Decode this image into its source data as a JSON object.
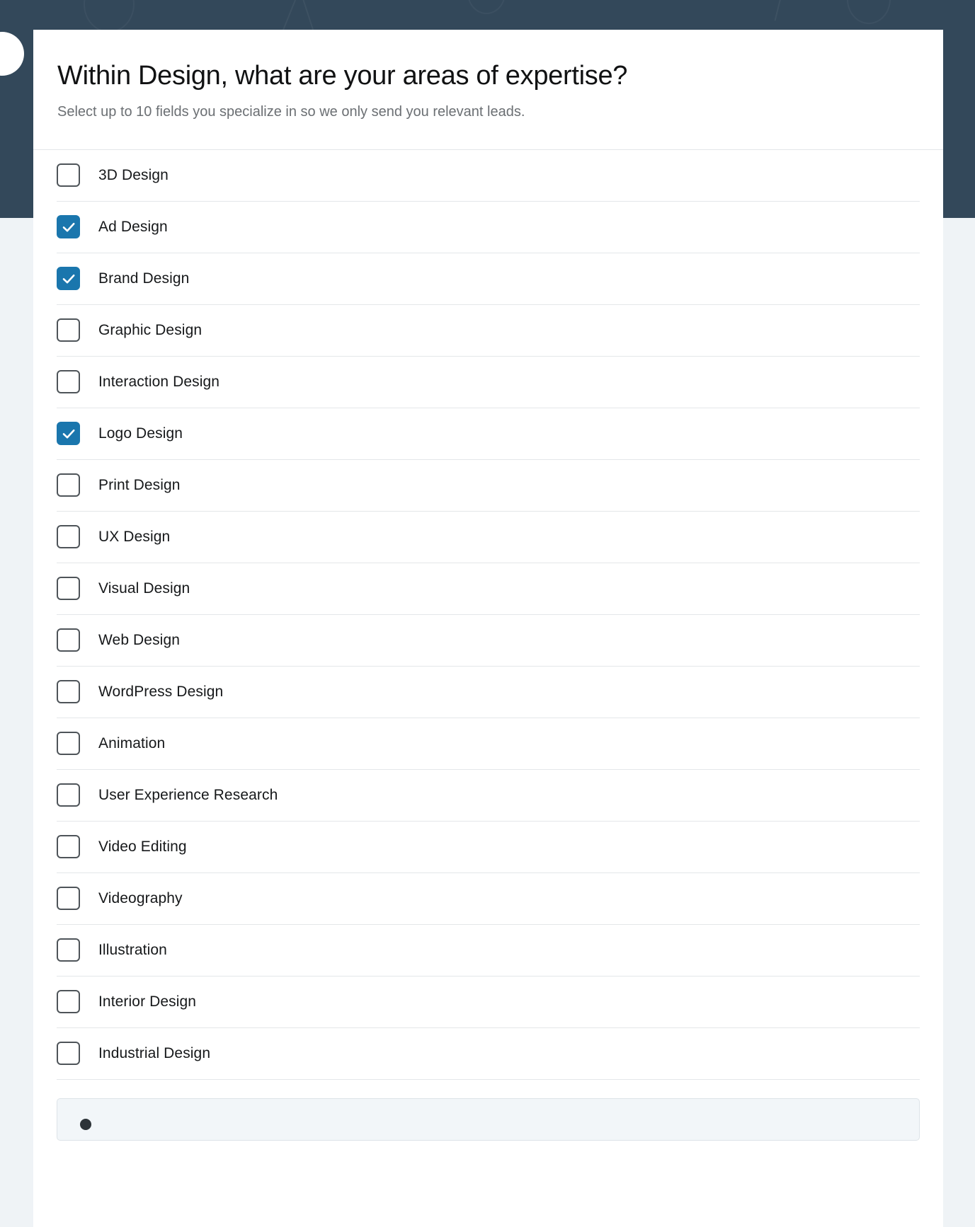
{
  "theme": {
    "background_dark": "#33485a",
    "background_light": "#eff3f6",
    "card_background": "#ffffff",
    "accent_checked": "#1a76ad",
    "checkbox_border": "#4e5459",
    "divider": "#e4e7e9",
    "title_color": "#111213",
    "subtitle_color": "#6b6f73",
    "label_color": "#16181a",
    "bottom_panel_background": "#f2f6f9"
  },
  "modal": {
    "title": "Within Design, what are your areas of expertise?",
    "subtitle": "Select up to 10 fields you specialize in so we only send you relevant leads.",
    "close_icon": "close-icon"
  },
  "options": [
    {
      "label": "3D Design",
      "checked": false
    },
    {
      "label": "Ad Design",
      "checked": true
    },
    {
      "label": "Brand Design",
      "checked": true
    },
    {
      "label": "Graphic Design",
      "checked": false
    },
    {
      "label": "Interaction Design",
      "checked": false
    },
    {
      "label": "Logo Design",
      "checked": true
    },
    {
      "label": "Print Design",
      "checked": false
    },
    {
      "label": "UX Design",
      "checked": false
    },
    {
      "label": "Visual Design",
      "checked": false
    },
    {
      "label": "Web Design",
      "checked": false
    },
    {
      "label": "WordPress Design",
      "checked": false
    },
    {
      "label": "Animation",
      "checked": false
    },
    {
      "label": "User Experience Research",
      "checked": false
    },
    {
      "label": "Video Editing",
      "checked": false
    },
    {
      "label": "Videography",
      "checked": false
    },
    {
      "label": "Illustration",
      "checked": false
    },
    {
      "label": "Interior Design",
      "checked": false
    },
    {
      "label": "Industrial Design",
      "checked": false
    }
  ],
  "selection": {
    "max": 10,
    "selected_count": 3
  }
}
